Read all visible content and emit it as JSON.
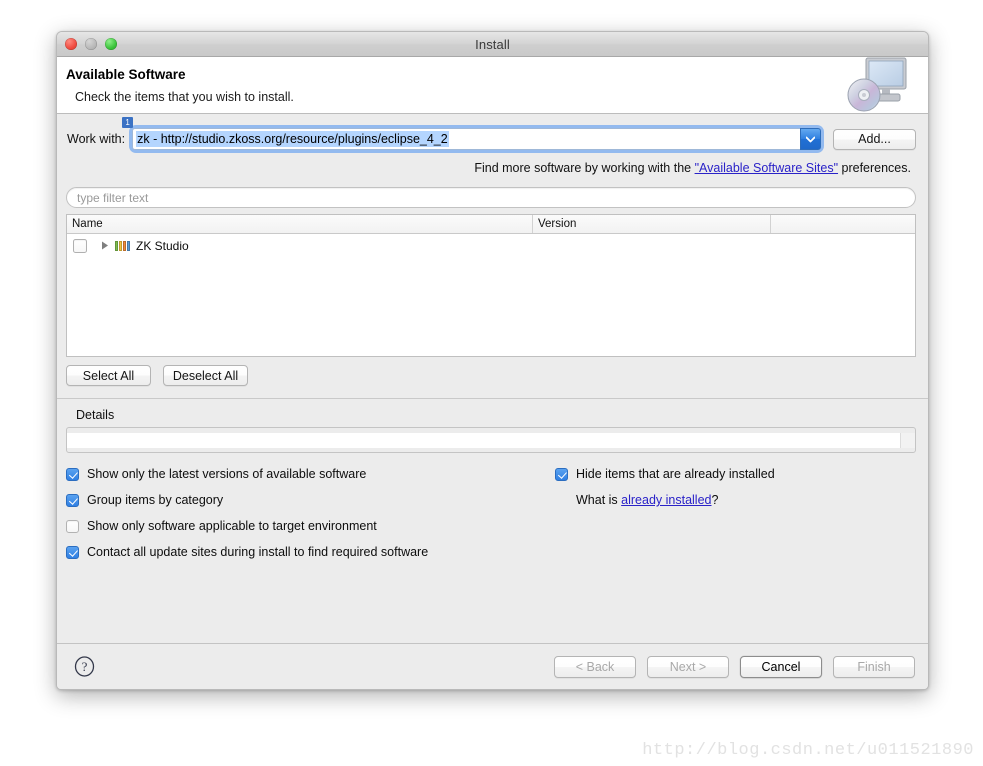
{
  "window": {
    "title": "Install",
    "traffic_lights": [
      "close-red",
      "minimize-gray",
      "zoom-green"
    ]
  },
  "header": {
    "title": "Available Software",
    "subtitle": "Check the items that you wish to install.",
    "icon": "computer-disc-icon"
  },
  "work_with": {
    "label": "Work with:",
    "value": "zk - http://studio.zkoss.org/resource/plugins/eclipse_4_2",
    "badge": "1",
    "add_button": "Add...",
    "dropdown_icon": "chevron-down-icon"
  },
  "find_more": {
    "prefix": "Find more software by working with the ",
    "link": "\"Available Software Sites\"",
    "suffix": " preferences."
  },
  "filter": {
    "placeholder": "type filter text",
    "value": ""
  },
  "table": {
    "columns": [
      "Name",
      "Version",
      ""
    ],
    "rows": [
      {
        "checked": false,
        "expanded": false,
        "icon": "zk-studio-icon",
        "name": "ZK Studio",
        "version": ""
      }
    ]
  },
  "selection_buttons": {
    "select_all": "Select All",
    "deselect_all": "Deselect All"
  },
  "details": {
    "label": "Details",
    "text": ""
  },
  "options": {
    "left": [
      {
        "label": "Show only the latest versions of available software",
        "checked": true
      },
      {
        "label": "Group items by category",
        "checked": true
      },
      {
        "label": "Show only software applicable to target environment",
        "checked": false
      },
      {
        "label": "Contact all update sites during install to find required software",
        "checked": true
      }
    ],
    "right": [
      {
        "label": "Hide items that are already installed",
        "checked": true
      }
    ],
    "what_is": {
      "prefix": "What is ",
      "link": "already installed",
      "suffix": "?"
    }
  },
  "footer": {
    "help_icon": "question-mark-icon",
    "buttons": [
      {
        "label": "< Back",
        "state": "disabled"
      },
      {
        "label": "Next >",
        "state": "disabled"
      },
      {
        "label": "Cancel",
        "state": "default"
      },
      {
        "label": "Finish",
        "state": "disabled"
      }
    ]
  },
  "watermark": "http://blog.csdn.net/u011521890",
  "colors": {
    "accent_blue": "#2f7fe3",
    "link": "#2a22c8",
    "selection": "#b4d5fe",
    "window_bg": "#ececec"
  }
}
